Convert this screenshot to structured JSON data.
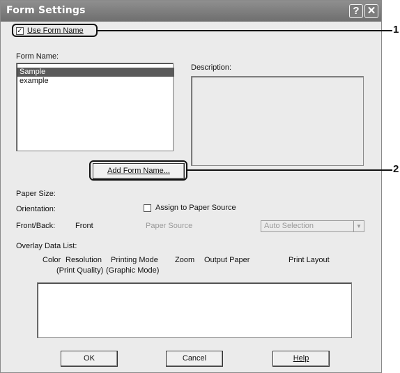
{
  "dialog": {
    "title": "Form Settings",
    "help_glyph": "?",
    "close_glyph": "✕"
  },
  "form": {
    "use_form_name_label": "Use Form Name",
    "use_form_name_checked": true,
    "check_glyph": "✓",
    "form_name_label": "Form Name:",
    "items": [
      "Sample",
      "example"
    ],
    "selected": "Sample",
    "description_label": "Description:",
    "add_button": "Add Form Name..."
  },
  "properties": {
    "paper_size_label": "Paper Size:",
    "orientation_label": "Orientation:",
    "front_back_label": "Front/Back:",
    "front_back_value": "Front",
    "assign_label": "Assign to Paper Source",
    "assign_checked": false,
    "paper_source_label": "Paper Source",
    "paper_source_value": "Auto Selection",
    "dropdown_glyph": "▼"
  },
  "overlay": {
    "list_label": "Overlay Data List:",
    "columns_line1": [
      "Color",
      "Resolution",
      "Printing Mode",
      "Zoom",
      "Output Paper",
      "Print Layout"
    ],
    "columns_line2": [
      "(Print Quality)",
      "(Graphic Mode)"
    ]
  },
  "buttons": {
    "ok": "OK",
    "cancel": "Cancel",
    "help": "Help"
  },
  "callouts": [
    "1",
    "2"
  ]
}
